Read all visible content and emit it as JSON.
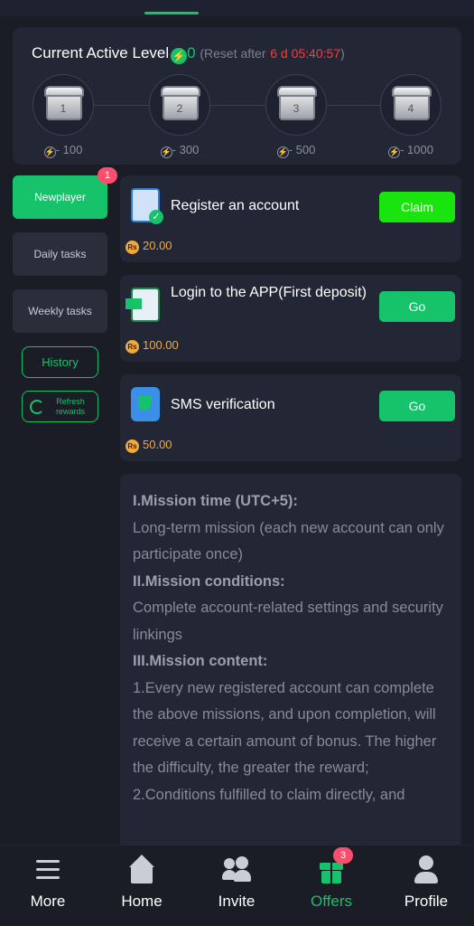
{
  "level": {
    "title": "Current Active Level",
    "count": "0",
    "reset_label": "(Reset after",
    "countdown": "6 d 05:40:57",
    "reset_close": ")",
    "chests": [
      {
        "num": "1",
        "cost": "- 100"
      },
      {
        "num": "2",
        "cost": "- 300"
      },
      {
        "num": "3",
        "cost": "- 500"
      },
      {
        "num": "4",
        "cost": "- 1000"
      }
    ]
  },
  "sidebar": {
    "newplayer": "Newplayer",
    "newplayer_badge": "1",
    "daily": "Daily tasks",
    "weekly": "Weekly tasks",
    "history": "History",
    "refresh": "Refresh rewards"
  },
  "tasks": [
    {
      "name": "Register an account",
      "button": "Claim",
      "reward": "20.00",
      "icon": "clipboard-check-icon"
    },
    {
      "name": "Login to the APP(First deposit)",
      "button": "Go",
      "reward": "100.00",
      "icon": "phone-login-icon"
    },
    {
      "name": "SMS verification",
      "button": "Go",
      "reward": "50.00",
      "icon": "shield-phone-icon"
    }
  ],
  "currency_symbol": "Rs",
  "rules": {
    "h1": "I.Mission time (UTC+5):",
    "p1": "Long-term mission (each new account can only participate once)",
    "h2": "II.Mission conditions:",
    "p2": "Complete account-related settings and security linkings",
    "h3": "III.Mission content:",
    "p3": "1.Every new registered account can complete the above missions, and upon completion, will receive a certain amount of bonus. The higher the difficulty, the greater the reward;",
    "p4": "2.Conditions fulfilled to claim directly, and"
  },
  "nav": {
    "more": "More",
    "home": "Home",
    "invite": "Invite",
    "offers": "Offers",
    "offers_badge": "3",
    "profile": "Profile"
  },
  "colors": {
    "accent": "#16c26a",
    "claim": "#19e40d",
    "countdown": "#ff3a3a",
    "reward": "#f3a93a",
    "badge": "#ff4d6d"
  }
}
